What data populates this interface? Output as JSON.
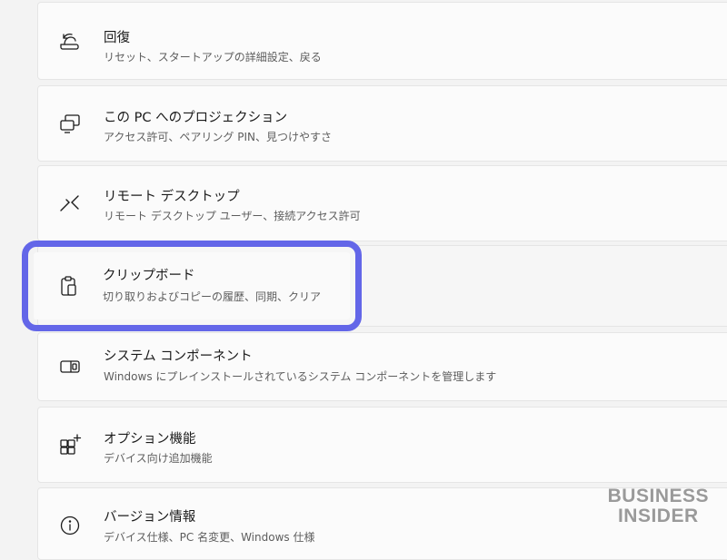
{
  "settings_list": [
    {
      "icon": "recovery-icon",
      "title": "回復",
      "desc": "リセット、スタートアップの詳細設定、戻る"
    },
    {
      "icon": "project-to-pc-icon",
      "title": "この PC へのプロジェクション",
      "desc": "アクセス許可、ペアリング PIN、見つけやすさ"
    },
    {
      "icon": "remote-desktop-icon",
      "title": "リモート デスクトップ",
      "desc": "リモート デスクトップ ユーザー、接続アクセス許可"
    },
    {
      "icon": "clipboard-icon",
      "title": "クリップボード",
      "desc": "切り取りおよびコピーの履歴、同期、クリア"
    },
    {
      "icon": "system-components-icon",
      "title": "システム コンポーネント",
      "desc": "Windows にプレインストールされているシステム コンポーネントを管理します"
    },
    {
      "icon": "optional-features-icon",
      "title": "オプション機能",
      "desc": "デバイス向け追加機能"
    },
    {
      "icon": "about-info-icon",
      "title": "バージョン情報",
      "desc": "デバイス仕様、PC 名変更、Windows 仕様"
    }
  ],
  "highlight_color": "#6366e8",
  "watermark": {
    "line1": "BUSINESS",
    "line2": "INSIDER"
  }
}
